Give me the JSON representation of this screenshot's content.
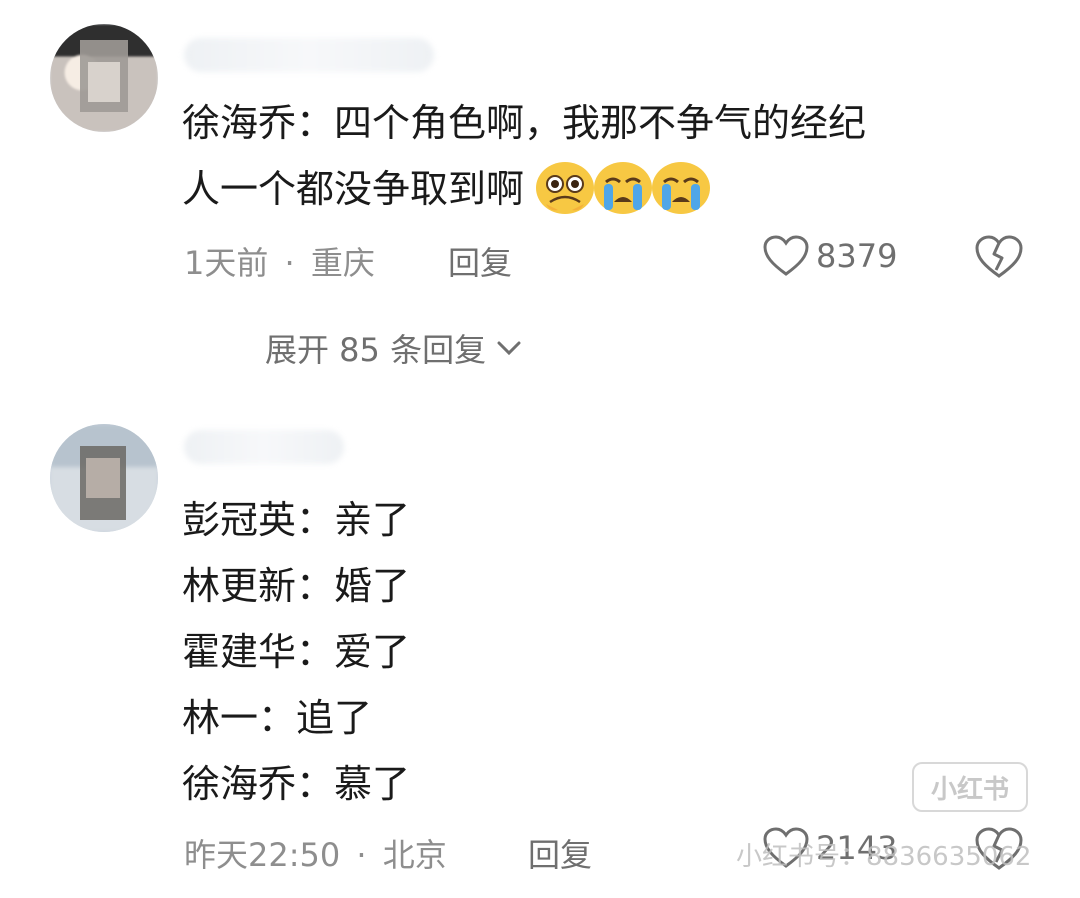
{
  "comments": [
    {
      "text_line1": "徐海乔：四个角色啊，我那不争气的经纪",
      "text_line2": "人一个都没争取到啊",
      "emojis": [
        "pleading-face",
        "crying-face",
        "crying-face"
      ],
      "time": "1天前",
      "sep": "·",
      "location": "重庆",
      "reply_label": "回复",
      "likes": "8379",
      "expand_label": "展开 85 条回复"
    },
    {
      "lines": [
        "彭冠英：亲了",
        "林更新：婚了",
        "霍建华：爱了",
        "林一：追了",
        "徐海乔：慕了"
      ],
      "time": "昨天22:50",
      "sep": "·",
      "location": "北京",
      "reply_label": "回复",
      "likes": "2143"
    }
  ],
  "watermark": {
    "badge": "小红书",
    "text": "小红书号：8836635062"
  },
  "colors": {
    "meta": "#8e8e8e",
    "text": "#1a1a1a",
    "icon": "#6f6f6f",
    "emoji": "#f7c843",
    "tear": "#4fa6e8"
  }
}
